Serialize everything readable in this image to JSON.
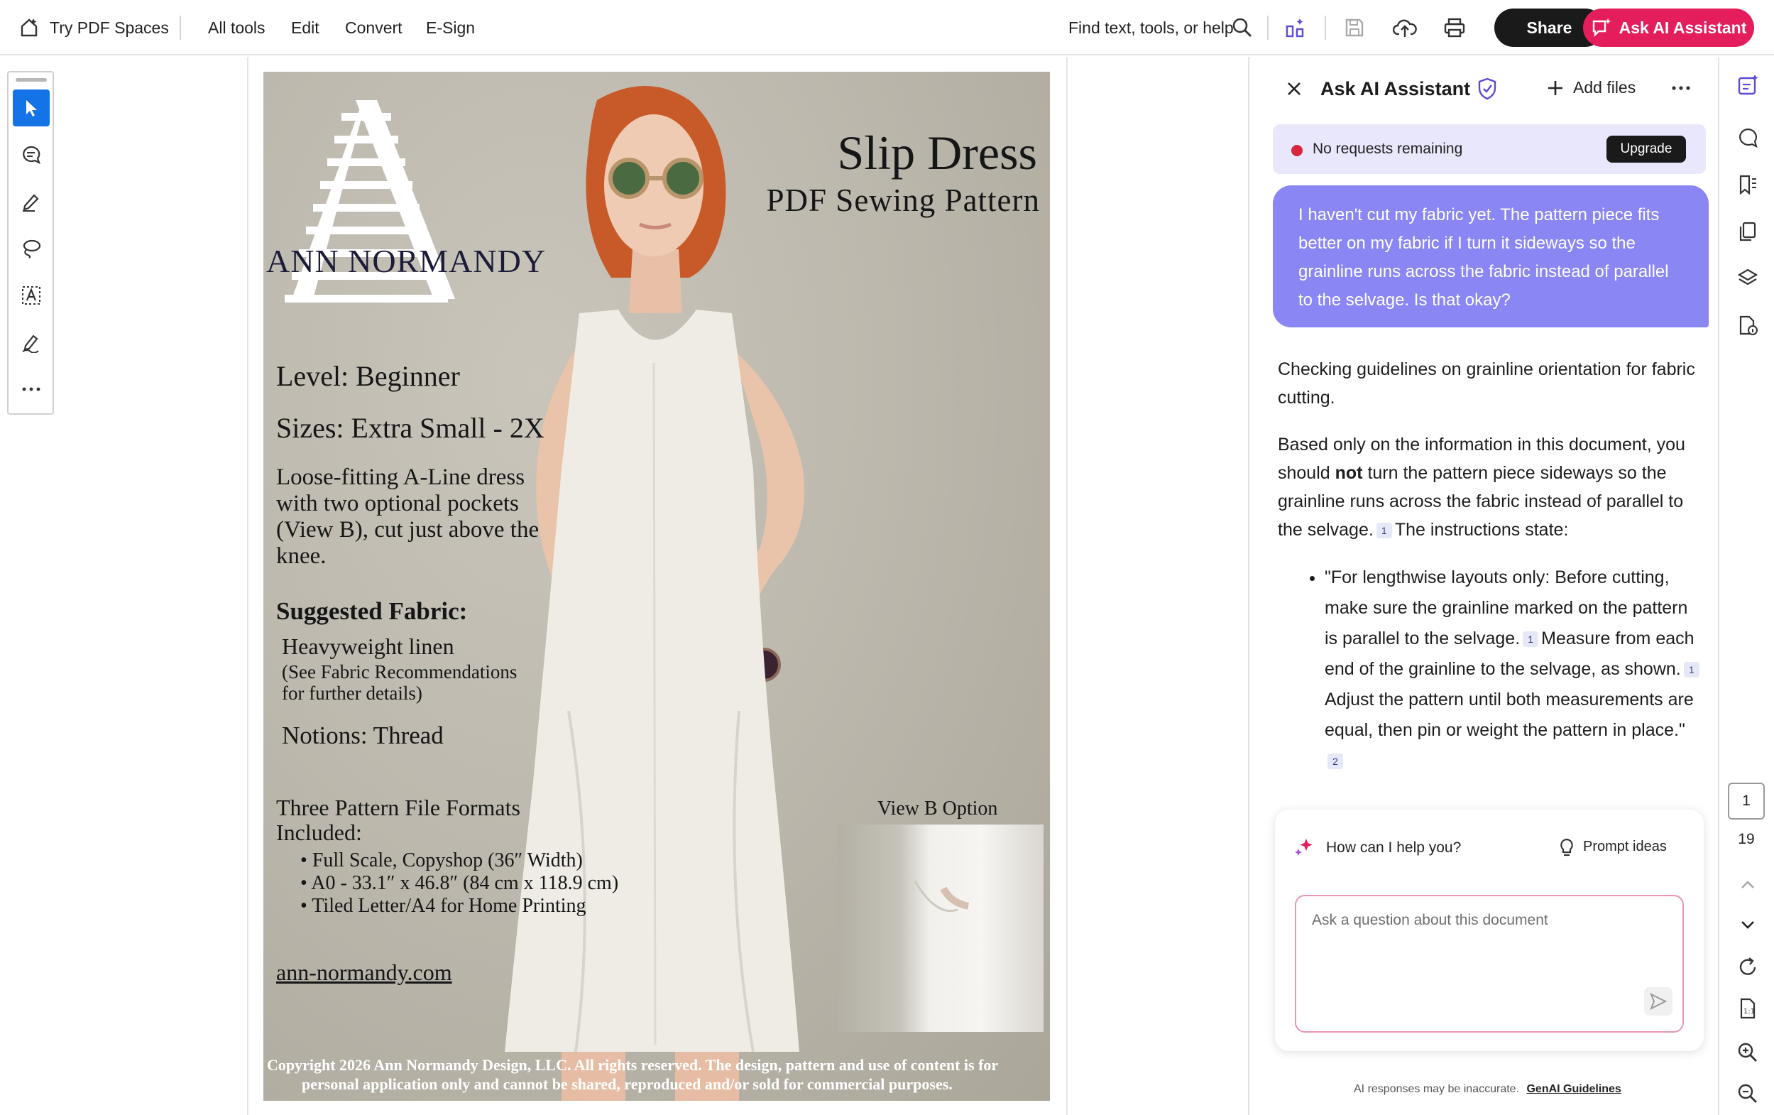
{
  "topbar": {
    "spaces_label": "Try PDF Spaces",
    "menu": [
      "All tools",
      "Edit",
      "Convert",
      "E-Sign"
    ],
    "search_label": "Find text, tools, or help",
    "share_label": "Share",
    "ask_ai_label": "Ask AI Assistant"
  },
  "document": {
    "brand": "ANN NORMANDY",
    "title": "Slip Dress",
    "subtitle": "PDF Sewing Pattern",
    "level": "Level: Beginner",
    "sizes": "Sizes: Extra Small - 2X",
    "description": [
      "Loose-fitting A-Line dress",
      "with two optional pockets",
      "(View B), cut just above the",
      "knee."
    ],
    "fabric_heading": "Suggested Fabric:",
    "fabric_name": "Heavyweight linen",
    "fabric_note": [
      "(See Fabric Recommendations",
      "for further details)"
    ],
    "notions": "Notions: Thread",
    "formats_heading": [
      "Three Pattern File Formats",
      "Included:"
    ],
    "formats": [
      "Full Scale, Copyshop (36″ Width)",
      "A0 - 33.1″ x 46.8″ (84 cm x 118.9 cm)",
      "Tiled Letter/A4 for Home Printing"
    ],
    "website": "ann-normandy.com",
    "view_b_label": "View B Option",
    "copyright": [
      "Copyright 2026 Ann Normandy Design, LLC. All rights reserved. The design, pattern and use of content is for",
      "personal application only and cannot be shared, reproduced and/or sold for commercial purposes."
    ]
  },
  "ai_panel": {
    "title": "Ask AI Assistant",
    "add_files_label": "Add files",
    "banner_text": "No requests remaining",
    "upgrade_label": "Upgrade",
    "user_message": "I haven't cut my fabric yet. The pattern piece fits better on my fabric if I turn it sideways so the grainline runs across the fabric instead of parallel to the selvage. Is that okay?",
    "status_line": "Checking guidelines on grainline orientation for fabric cutting.",
    "answer_before_bold": "Based only on the information in this document, you should ",
    "answer_bold": "not",
    "answer_after_bold": " turn the pattern piece sideways so the grainline runs across the fabric instead of parallel to the selvage.",
    "answer_tail": "The instructions state:",
    "quote_part1": "\"For lengthwise layouts only: Before cutting, make sure the grainline marked on the pattern is parallel to the selvage.",
    "quote_part2": "Measure from each end of the grainline to the selvage, as shown.",
    "quote_part3": "Adjust the pattern until both measurements are equal, then pin or weight the pattern in place.\"",
    "citations": [
      "1",
      "1",
      "1",
      "2"
    ],
    "help_prompt": "How can I help you?",
    "prompt_ideas_label": "Prompt ideas",
    "input_placeholder": "Ask a question about this document",
    "disclaimer": "AI responses may be inaccurate.",
    "guidelines_link": "GenAI Guidelines"
  },
  "right_rail": {
    "current_page": "1",
    "total_pages": "19"
  },
  "colors": {
    "ai_accent": "#e41e5c",
    "bubble": "#8a86f3",
    "active_tool": "#1473e6",
    "banner": "#e9e7fb"
  }
}
